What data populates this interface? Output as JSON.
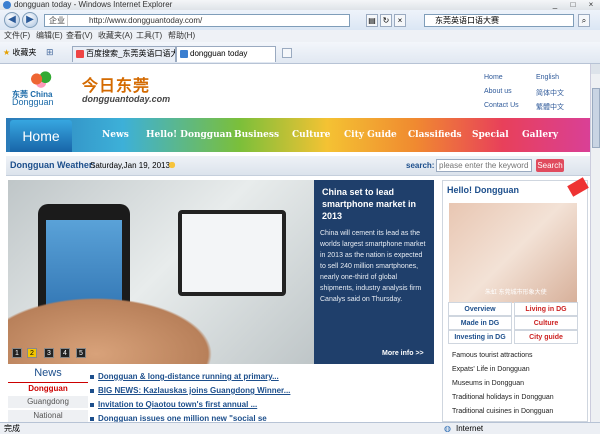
{
  "window": {
    "title": "dongguan today - Windows Internet Explorer"
  },
  "address": {
    "zone": "企业",
    "url": "http://www.dongguantoday.com/",
    "search_text": "东莞英语口语大赛"
  },
  "menu": [
    "文件(F)",
    "编辑(E)",
    "查看(V)",
    "收藏夹(A)",
    "工具(T)",
    "帮助(H)"
  ],
  "favbar": {
    "favorites_label": "收藏夹"
  },
  "tabs": [
    {
      "label": "百度搜索_东莞英语口语大赛"
    },
    {
      "label": "dongguan today"
    }
  ],
  "site": {
    "logo_en": "东莞 China",
    "logo_en2": "Dongguan",
    "brand": "今日东莞",
    "brand_url": "dongguantoday.com",
    "toplinks": [
      "Home",
      "About us",
      "Contact Us",
      "English",
      "简体中文",
      "繁體中文"
    ],
    "nav": [
      "Home",
      "News",
      "Hello! Dongguan",
      "Business",
      "Culture",
      "City Guide",
      "Classifieds",
      "Special",
      "Gallery"
    ],
    "weather_label": "Dongguan Weather:",
    "date": "Saturday,Jan 19, 2013",
    "search_label": "search:",
    "search_placeholder": "please enter the keyword",
    "search_button": "Search"
  },
  "slider": {
    "headline": "China set to lead smartphone market in 2013",
    "body": "China will cement its lead as the worlds largest smartphone market in 2013 as the nation is expected to sell 240 million smartphones, nearly one-third of global shipments, industry analysis firm Canalys said on Thursday.",
    "more": "More info >>",
    "pages": [
      "1",
      "2",
      "3",
      "4",
      "5"
    ]
  },
  "news_box": {
    "title": "News",
    "tabs": [
      "Dongguan",
      "Guangdong",
      "National"
    ]
  },
  "headlines": [
    "Dongguan & long-distance running at primary...",
    "BIG NEWS: Kazlauskas joins Guangdong Winner...",
    "Invitation to Qiaotou town's first annual ...",
    "Dongguan issues one million new \"social se"
  ],
  "right_panel": {
    "title": "Hello! Dongguan",
    "photo_caption": "朱虹 东莞城市形象大使",
    "links": [
      "Overview",
      "Living in DG",
      "Made in DG",
      "Culture",
      "Investing in DG",
      "City guide"
    ],
    "guide": [
      "Famous tourist attractions",
      "Expats' Life in Dongguan",
      "Museums in Dongguan",
      "Traditional holidays in Dongguan",
      "Traditional cuisines in Dongguan"
    ]
  },
  "status": {
    "left": "完成",
    "zone": "Internet"
  }
}
